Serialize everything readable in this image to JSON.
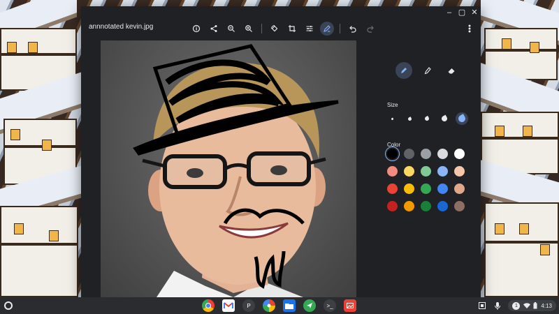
{
  "window": {
    "filename": "annnotated kevin.jpg",
    "caption_buttons": [
      "–",
      "▢",
      "✕"
    ]
  },
  "toolbar": {
    "buttons": [
      {
        "name": "info-icon"
      },
      {
        "name": "share-icon"
      },
      {
        "name": "zoom-out-icon"
      },
      {
        "name": "zoom-in-icon"
      },
      {
        "name": "rotate-icon"
      },
      {
        "name": "crop-icon"
      },
      {
        "name": "adjust-icon"
      },
      {
        "name": "annotate-icon",
        "active": true
      },
      {
        "name": "undo-icon"
      },
      {
        "name": "redo-icon",
        "disabled": true
      }
    ],
    "more_icon": "more-vert-icon"
  },
  "panel": {
    "modes": [
      {
        "name": "pen-mode",
        "icon": "pen-icon",
        "active": true
      },
      {
        "name": "highlighter-mode",
        "icon": "highlighter-icon"
      },
      {
        "name": "eraser-mode",
        "icon": "eraser-icon"
      }
    ],
    "size_label": "Size",
    "sizes": [
      1,
      2,
      3,
      4,
      5
    ],
    "selected_size": 5,
    "color_label": "Color",
    "colors": [
      "#000000",
      "#5f6368",
      "#9aa0a6",
      "#dadce0",
      "#ffffff",
      "#f28b82",
      "#fdd663",
      "#81c995",
      "#8ab4f8",
      "#f6c6a8",
      "#ea4335",
      "#fbbc04",
      "#34a853",
      "#4285f4",
      "#e2a68a",
      "#c5221f",
      "#f29900",
      "#188038",
      "#1967d2",
      "#8d6e63"
    ],
    "selected_color": 0
  },
  "shelf": {
    "apps": [
      {
        "name": "chrome",
        "color": "#e8eaed"
      },
      {
        "name": "gmail",
        "color": "#ffffff"
      },
      {
        "name": "p-app",
        "label": "P",
        "color": "#3c4043"
      },
      {
        "name": "photos",
        "color": "#ffffff"
      },
      {
        "name": "files",
        "color": "#1a73e8"
      },
      {
        "name": "messages",
        "color": "#34a853"
      },
      {
        "name": "terminal",
        "label": ">_",
        "color": "#3c4043"
      },
      {
        "name": "gallery",
        "color": "#ea4335"
      }
    ],
    "notification_count": "1",
    "time": "4:13"
  }
}
